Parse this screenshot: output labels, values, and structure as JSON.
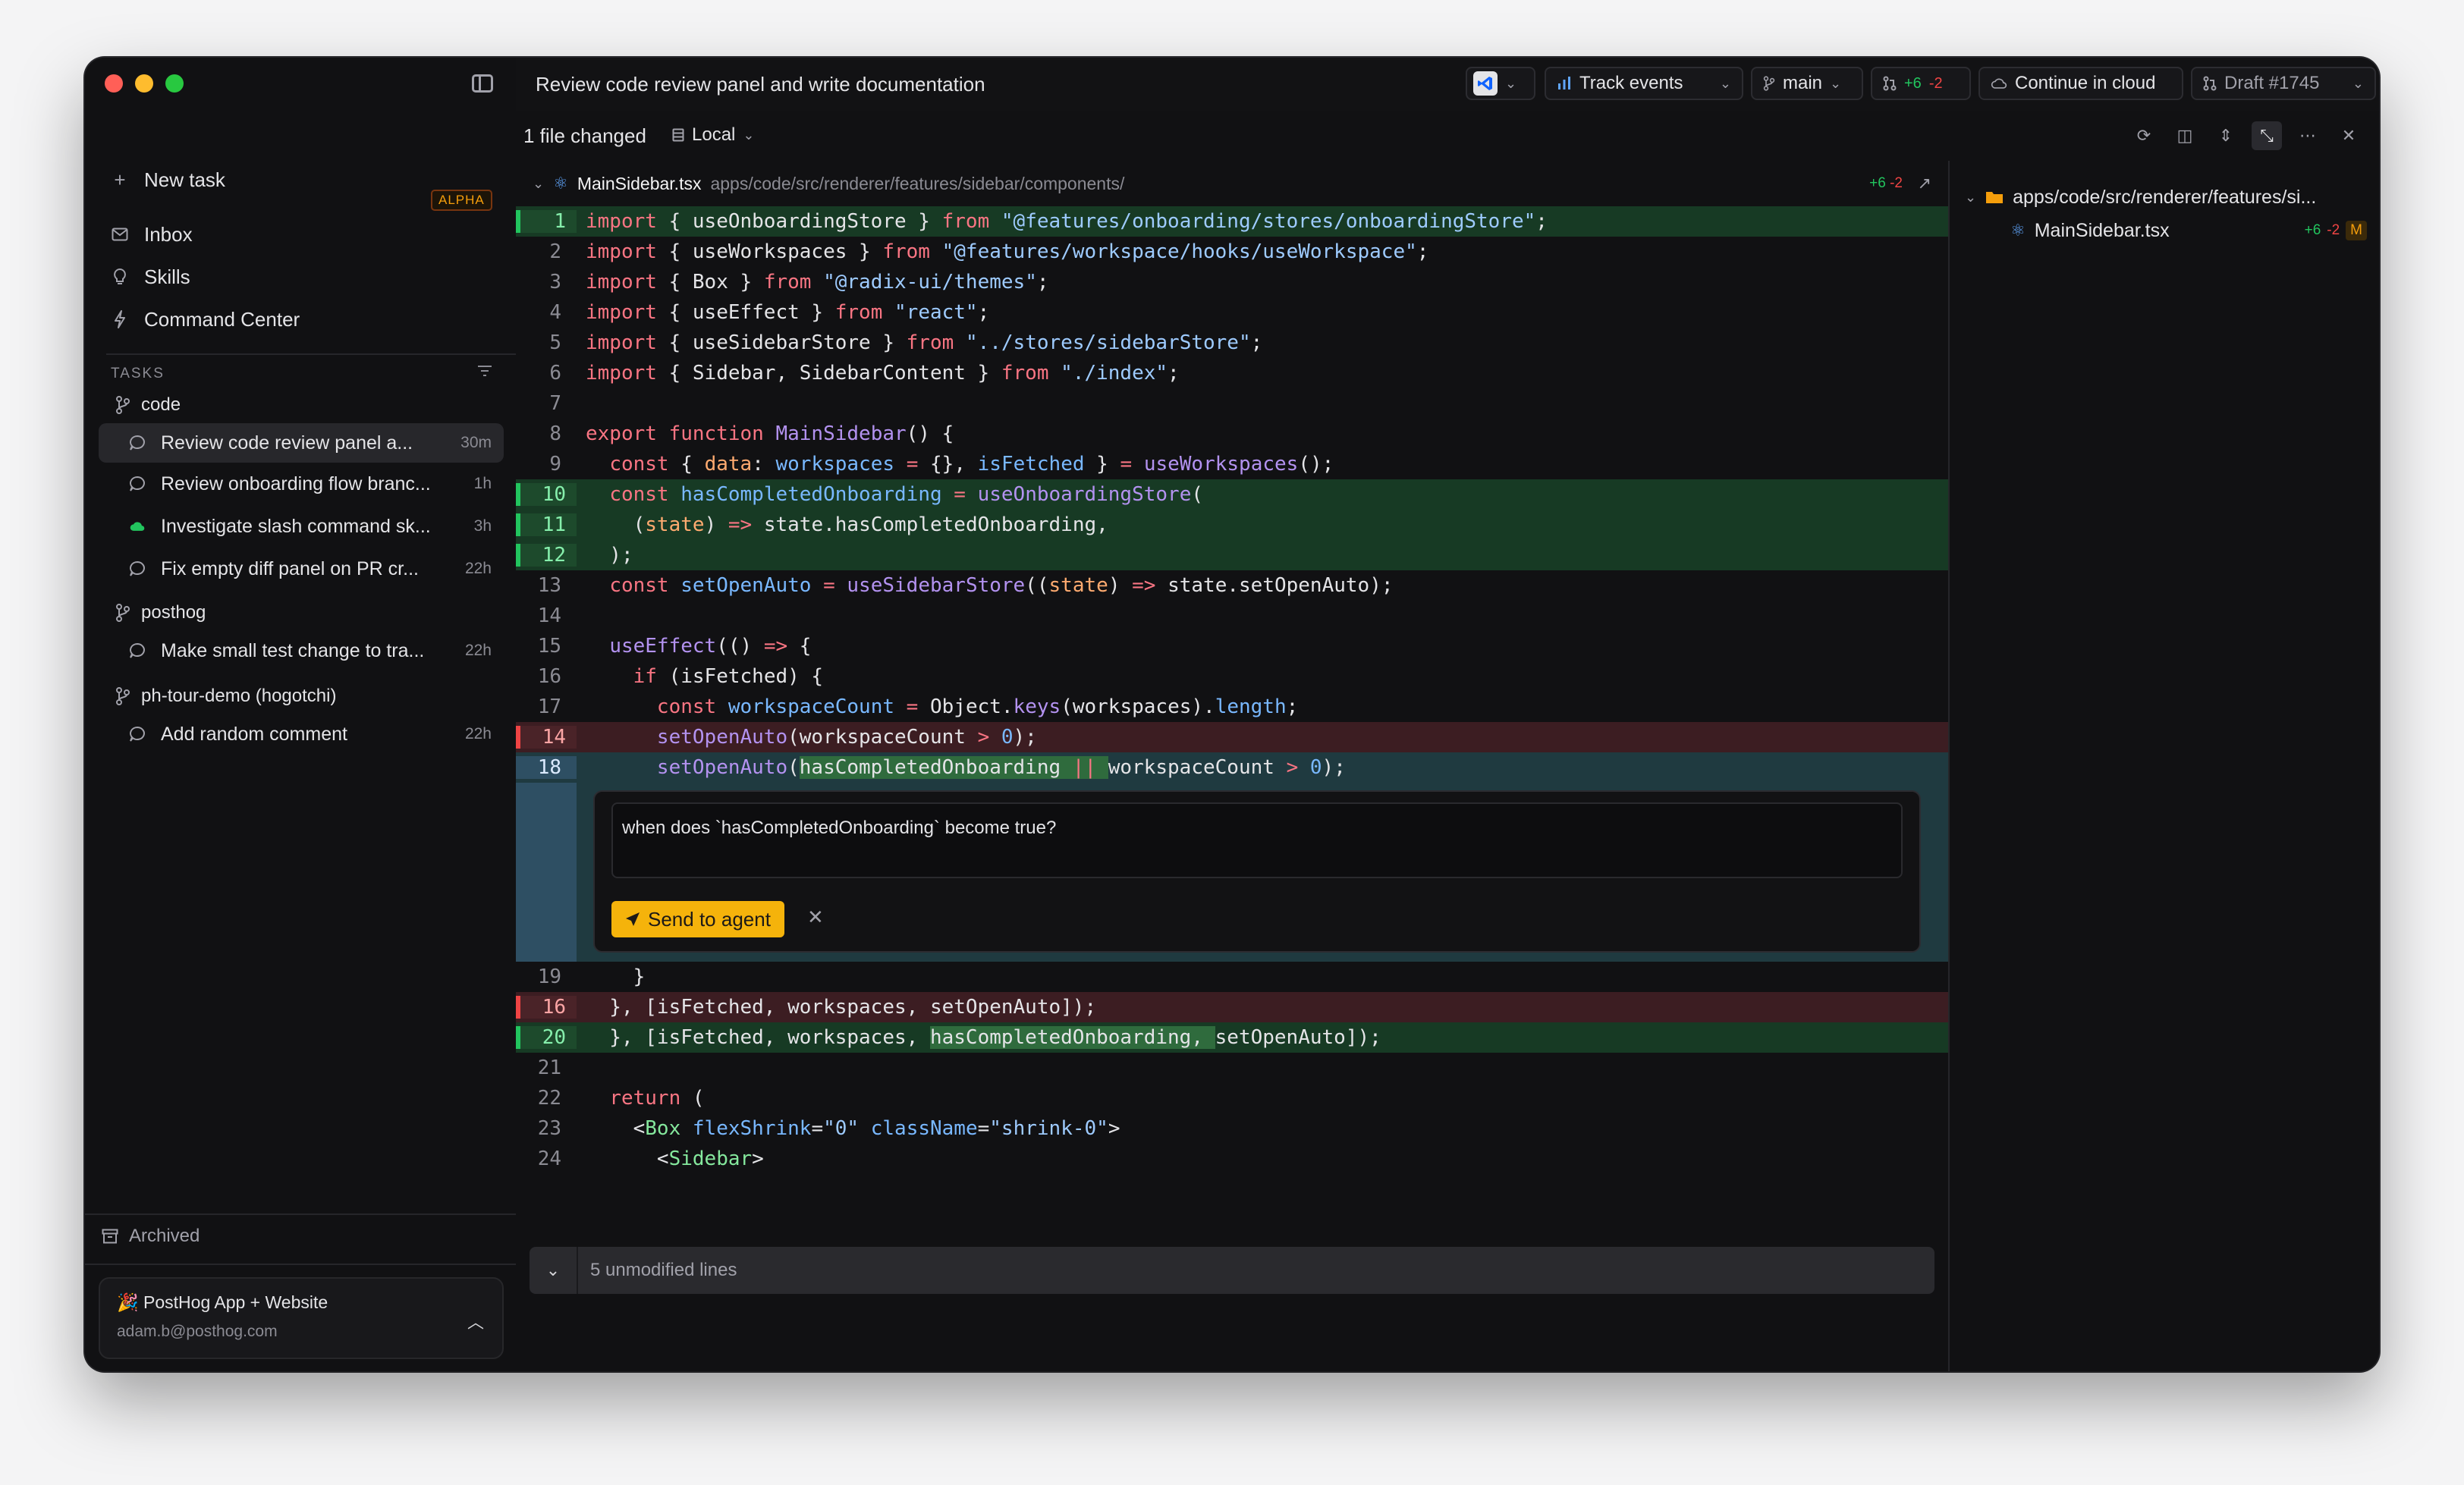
{
  "sidebar": {
    "nav": [
      {
        "label": "New task",
        "icon": "plus-icon"
      },
      {
        "label": "Inbox",
        "icon": "inbox-icon",
        "badge": "ALPHA"
      },
      {
        "label": "Skills",
        "icon": "lightbulb-icon"
      },
      {
        "label": "Command Center",
        "icon": "bolt-icon"
      }
    ],
    "tasks_heading": "TASKS",
    "repos": [
      {
        "name": "code",
        "tasks": [
          {
            "title": "Review code review panel a...",
            "time": "30m",
            "status": "active"
          },
          {
            "title": "Review onboarding flow branc...",
            "time": "1h",
            "status": "idle"
          },
          {
            "title": "Investigate slash command sk...",
            "time": "3h",
            "status": "cloud"
          },
          {
            "title": "Fix empty diff panel on PR cr...",
            "time": "22h",
            "status": "idle"
          }
        ]
      },
      {
        "name": "posthog",
        "tasks": [
          {
            "title": "Make small test change to tra...",
            "time": "22h",
            "status": "idle"
          }
        ]
      },
      {
        "name": "ph-tour-demo (hogotchi)",
        "tasks": [
          {
            "title": "Add random comment",
            "time": "22h",
            "status": "idle"
          }
        ]
      }
    ],
    "archived": "Archived",
    "org": {
      "name": "🎉 PostHog App + Website",
      "email": "adam.b@posthog.com"
    }
  },
  "topbar": {
    "title": "Review code review panel and write documentation",
    "track_events": "Track events",
    "branch": "main",
    "diff_plus": "+6",
    "diff_minus": "-2",
    "continue_cloud": "Continue in cloud",
    "draft": "Draft #1745"
  },
  "subbar": {
    "files_changed": "1 file changed",
    "location": "Local"
  },
  "diff": {
    "file_name": "MainSidebar.tsx",
    "file_path": "apps/code/src/renderer/features/sidebar/components/",
    "stat_plus": "+6",
    "stat_minus": "-2",
    "comment_text": "when does `hasCompletedOnboarding` become true?",
    "send_label": "Send to agent",
    "unmodified": "5 unmodified lines"
  },
  "tree": {
    "folder": "apps/code/src/renderer/features/si...",
    "file": "MainSidebar.tsx",
    "plus": "+6",
    "minus": "-2",
    "status": "M"
  },
  "colors": {
    "accent": "#f5b30b",
    "add_bg": "#173a24",
    "del_bg": "#3c1d22",
    "selected_bg": "#1f3a40"
  }
}
